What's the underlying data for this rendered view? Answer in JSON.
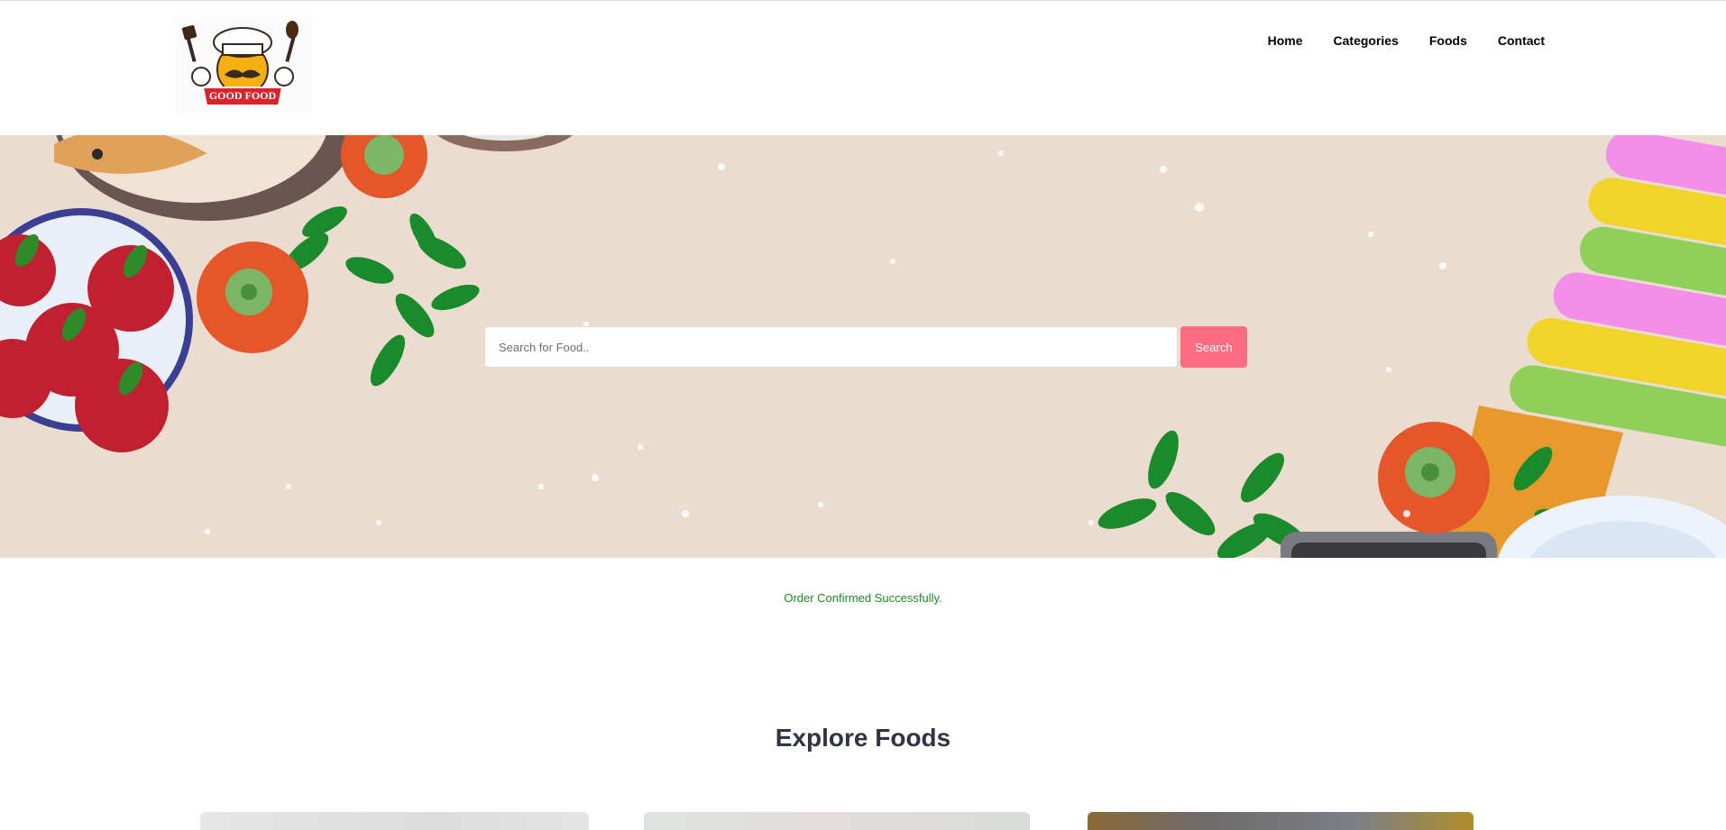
{
  "brand": {
    "logo_text": "GOOD FOOD"
  },
  "nav": {
    "items": [
      {
        "label": "Home"
      },
      {
        "label": "Categories"
      },
      {
        "label": "Foods"
      },
      {
        "label": "Contact"
      }
    ]
  },
  "search": {
    "placeholder": "Search for Food..",
    "value": "",
    "button_label": "Search",
    "button_color": "#ff6b81"
  },
  "status": {
    "message": "Order Confirmed Successfully.",
    "color": "#1d8a1d"
  },
  "explore": {
    "heading": "Explore Foods"
  },
  "hero": {
    "background_color": "#eaddd0"
  }
}
